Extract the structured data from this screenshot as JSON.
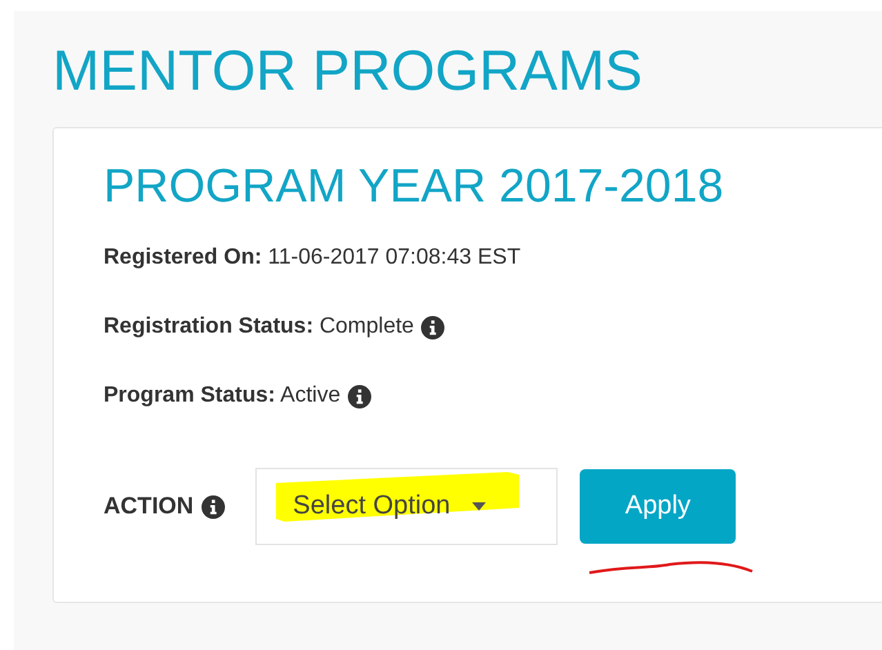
{
  "page_title": "MENTOR PROGRAMS",
  "program": {
    "title": "PROGRAM YEAR 2017-2018",
    "fields": [
      {
        "label": "Registered On:",
        "value": "11-06-2017 07:08:43 EST",
        "info": false
      },
      {
        "label": "Registration Status:",
        "value": "Complete",
        "info": true
      },
      {
        "label": "Program Status:",
        "value": "Active",
        "info": true
      }
    ],
    "action": {
      "label": "ACTION",
      "select": {
        "placeholder": "Select Option"
      },
      "button": "Apply"
    }
  }
}
